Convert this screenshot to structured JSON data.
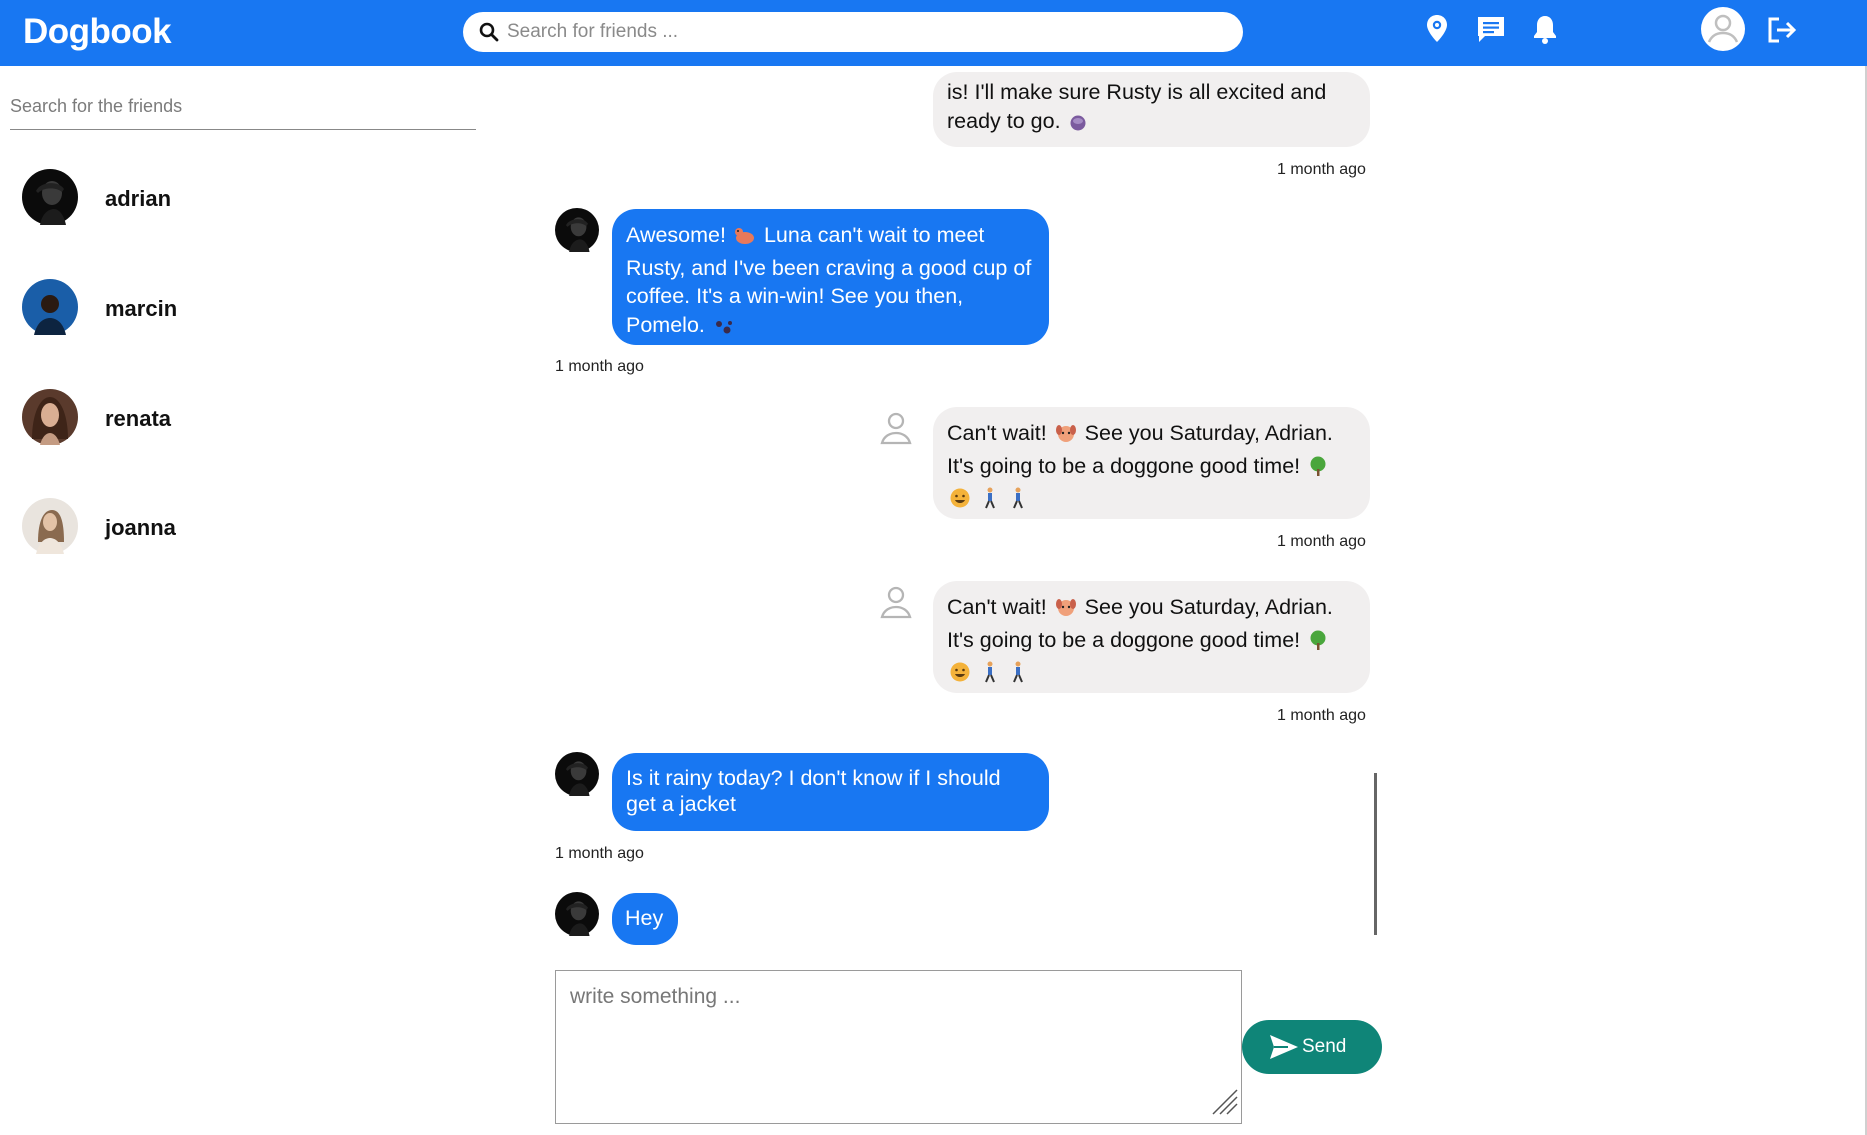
{
  "header": {
    "logo": "Dogbook",
    "search_placeholder": "Search for friends ...",
    "icons": [
      "location-pin-icon",
      "chat-icon",
      "bell-icon",
      "profile-icon",
      "logout-icon"
    ]
  },
  "sidebar": {
    "search_placeholder": "Search for the friends",
    "friends": [
      {
        "name": "adrian"
      },
      {
        "name": "marcin"
      },
      {
        "name": "renata"
      },
      {
        "name": "joanna"
      }
    ]
  },
  "messages": [
    {
      "from": "me",
      "lines": [
        "is! I'll make sure Rusty is all excited and",
        "ready to go."
      ],
      "time": "1 month ago"
    },
    {
      "from": "them",
      "lines": [
        "Awesome!",
        "Luna can't wait to meet",
        "Rusty, and I've been craving a good cup of",
        "coffee. It's a win-win! See you then,",
        "Pomelo."
      ],
      "time": "1 month ago"
    },
    {
      "from": "me",
      "lines": [
        "Can't wait!",
        "See you Saturday, Adrian.",
        "It's going to be a doggone good time!"
      ],
      "time": "1 month ago"
    },
    {
      "from": "me",
      "lines": [
        "Can't wait!",
        "See you Saturday, Adrian.",
        "It's going to be a doggone good time!"
      ],
      "time": "1 month ago"
    },
    {
      "from": "them",
      "lines": [
        "Is it rainy today? I don't know if I should",
        "get a jacket"
      ],
      "time": "1 month ago"
    },
    {
      "from": "them",
      "lines": [
        "Hey"
      ],
      "time": ""
    }
  ],
  "composer": {
    "placeholder": "write something ...",
    "send_label": "Send"
  },
  "colors": {
    "brand": "#1877f2",
    "send": "#0f8578",
    "my_bubble": "#f1efef"
  }
}
